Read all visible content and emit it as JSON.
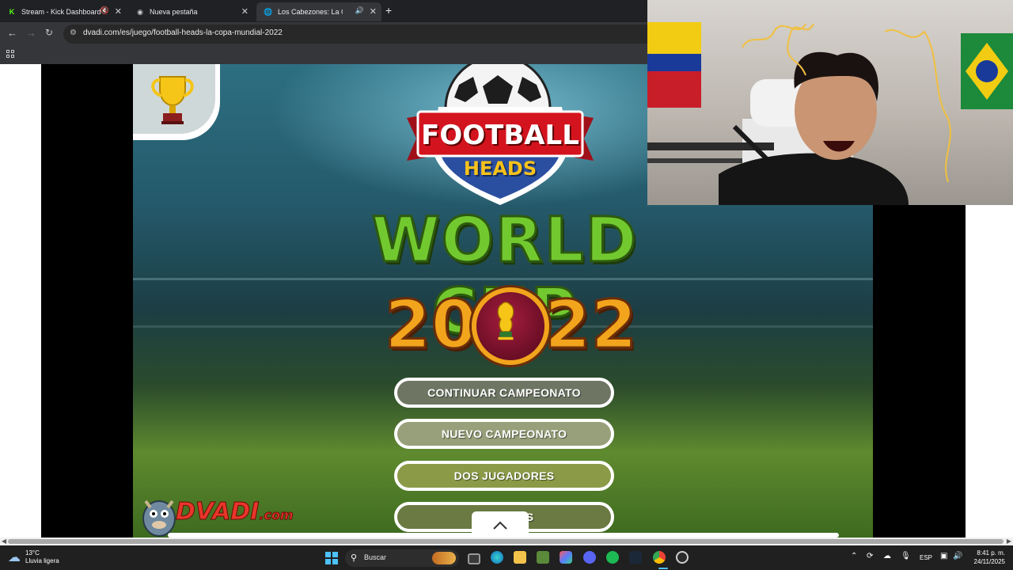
{
  "browser": {
    "tabs": [
      {
        "label": "Stream - Kick Dashboard",
        "favicon": "kick-icon",
        "active": false
      },
      {
        "label": "Nueva pestaña",
        "favicon": "chrome-icon",
        "active": false
      },
      {
        "label": "Los Cabezones: La Copa M",
        "favicon": "globe-icon",
        "active": true
      }
    ],
    "url": "dvadi.com/es/juego/football-heads-la-copa-mundial-2022"
  },
  "game": {
    "logo_title": "FOOTBALL",
    "logo_subtitle": "HEADS",
    "main_title": "WORLD CUP",
    "year_left": "20",
    "year_right": "22",
    "menu": [
      {
        "label": "CONTINUAR CAMPEONATO"
      },
      {
        "label": "NUEVO CAMPEONATO"
      },
      {
        "label": "DOS JUGADORES"
      },
      {
        "label": "MULTIJUGADOR",
        "visible_text": "M          OS"
      }
    ],
    "brand": "DVADI",
    "brand_suffix": ".com"
  },
  "taskbar": {
    "weather_temp": "13°C",
    "weather_desc": "Lluvia ligera",
    "search_placeholder": "Buscar",
    "language": "ESP",
    "time": "8:41 p. m.",
    "date": "24/11/2025"
  },
  "colors": {
    "accent_green": "#72c92f",
    "accent_gold": "#f2a41c",
    "kick_green": "#53fc18",
    "brand_red": "#e8352a"
  }
}
